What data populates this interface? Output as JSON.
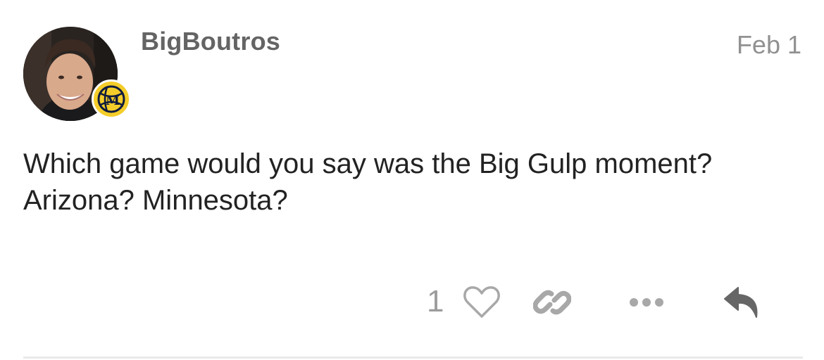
{
  "post": {
    "username": "BigBoutros",
    "date": "Feb 1",
    "body_lines": [
      "Which game would you say was the Big Gulp moment?",
      "Arizona? Minnesota?"
    ],
    "like_count": "1",
    "flair_letter": "M"
  },
  "icons": {
    "avatar": "user-avatar-photo",
    "flair": "basketball-m-flair-icon",
    "like": "heart-outline-icon",
    "link": "link-icon",
    "more": "ellipsis-icon",
    "reply": "reply-arrow-icon"
  },
  "colors": {
    "username": "#646464",
    "date": "#919191",
    "body_text": "#222222",
    "action_icons": "#a8a8a8",
    "reply_icon": "#666666",
    "flair_background": "#f4cd2a",
    "flair_navy": "#0f1b3d",
    "divider": "#e9e9e9"
  }
}
